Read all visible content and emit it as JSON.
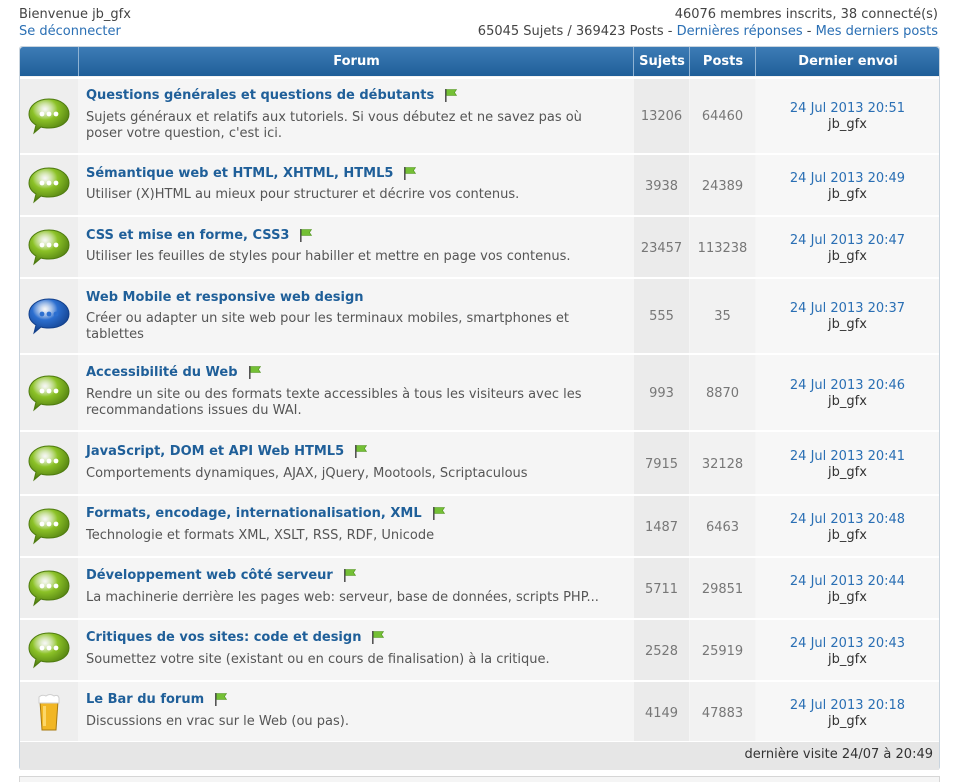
{
  "header": {
    "welcome": "Bienvenue jb_gfx",
    "logout": "Se déconnecter",
    "members": "46076 membres inscrits, 38 connecté(s)",
    "totals": "65045 Sujets / 369423 Posts",
    "sep1": " - ",
    "latest_replies": "Dernières réponses",
    "sep2": " - ",
    "my_posts": "Mes derniers posts"
  },
  "columns": {
    "forum": "Forum",
    "topics": "Sujets",
    "posts": "Posts",
    "last": "Dernier envoi"
  },
  "forums": [
    {
      "title": "Questions générales et questions de débutants",
      "desc": "Sujets généraux et relatifs aux tutoriels. Si vous débutez et ne savez pas où poser votre question, c'est ici.",
      "topics": "13206",
      "posts": "64460",
      "date": "24 Jul 2013 20:51",
      "user": "jb_gfx",
      "icon": "green-chat-bubble-icon",
      "flag": true
    },
    {
      "title": "Sémantique web et HTML, XHTML, HTML5",
      "desc": "Utiliser (X)HTML au mieux pour structurer et décrire vos contenus.",
      "topics": "3938",
      "posts": "24389",
      "date": "24 Jul 2013 20:49",
      "user": "jb_gfx",
      "icon": "green-chat-bubble-icon",
      "flag": true
    },
    {
      "title": "CSS et mise en forme, CSS3",
      "desc": "Utiliser les feuilles de styles pour habiller et mettre en page vos contenus.",
      "topics": "23457",
      "posts": "113238",
      "date": "24 Jul 2013 20:47",
      "user": "jb_gfx",
      "icon": "green-chat-bubble-icon",
      "flag": true
    },
    {
      "title": "Web Mobile et responsive web design",
      "desc": "Créer ou adapter un site web pour les terminaux mobiles, smartphones et tablettes",
      "topics": "555",
      "posts": "35",
      "date": "24 Jul 2013 20:37",
      "user": "jb_gfx",
      "icon": "blue-chat-bubble-icon",
      "flag": false
    },
    {
      "title": "Accessibilité du Web",
      "desc": "Rendre un site ou des formats texte accessibles à tous les visiteurs avec les recommandations issues du WAI.",
      "topics": "993",
      "posts": "8870",
      "date": "24 Jul 2013 20:46",
      "user": "jb_gfx",
      "icon": "green-chat-bubble-icon",
      "flag": true
    },
    {
      "title": "JavaScript, DOM et API Web HTML5",
      "desc": "Comportements dynamiques, AJAX, jQuery, Mootools, Scriptaculous",
      "topics": "7915",
      "posts": "32128",
      "date": "24 Jul 2013 20:41",
      "user": "jb_gfx",
      "icon": "green-chat-bubble-icon",
      "flag": true
    },
    {
      "title": "Formats, encodage, internationalisation, XML",
      "desc": "Technologie et formats XML, XSLT, RSS, RDF, Unicode",
      "topics": "1487",
      "posts": "6463",
      "date": "24 Jul 2013 20:48",
      "user": "jb_gfx",
      "icon": "green-chat-bubble-icon",
      "flag": true
    },
    {
      "title": "Développement web côté serveur",
      "desc": "La machinerie derrière les pages web: serveur, base de données, scripts PHP...",
      "topics": "5711",
      "posts": "29851",
      "date": "24 Jul 2013 20:44",
      "user": "jb_gfx",
      "icon": "green-chat-bubble-icon",
      "flag": true
    },
    {
      "title": "Critiques de vos sites: code et design",
      "desc": "Soumettez votre site (existant ou en cours de finalisation) à la critique.",
      "topics": "2528",
      "posts": "25919",
      "date": "24 Jul 2013 20:43",
      "user": "jb_gfx",
      "icon": "green-chat-bubble-icon",
      "flag": true
    },
    {
      "title": "Le Bar du forum",
      "desc": "Discussions en vrac sur le Web (ou pas).",
      "topics": "4149",
      "posts": "47883",
      "date": "24 Jul 2013 20:18",
      "user": "jb_gfx",
      "icon": "beer-glass-icon",
      "flag": true
    }
  ],
  "footer": {
    "last_visit": "dernière visite 24/07 à 20:49"
  },
  "colors": {
    "header_blue": "#1f5f99",
    "link_blue": "#2a6fb4",
    "bubble_green": "#7fb51f",
    "bubble_blue": "#1e5fc0",
    "flag_green": "#74c035"
  }
}
